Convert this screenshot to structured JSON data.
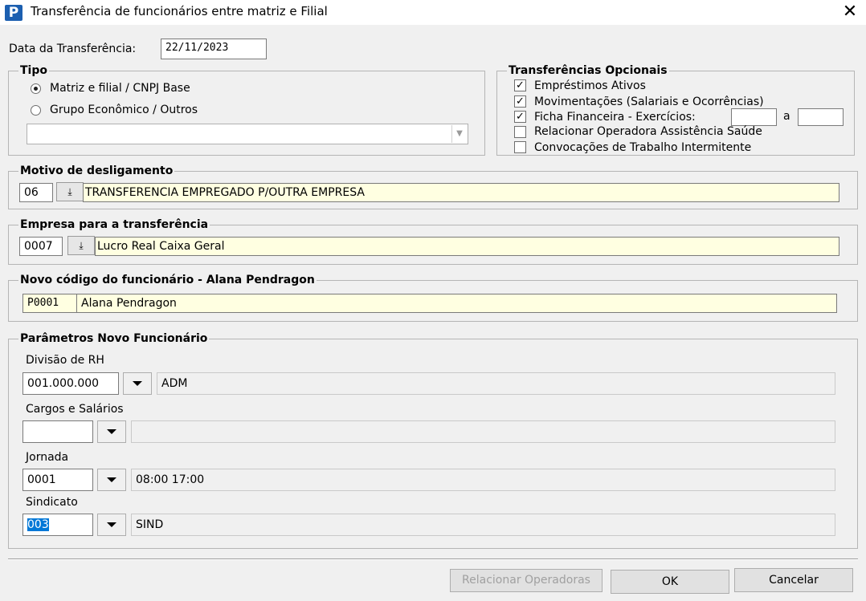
{
  "window": {
    "title": "Transferência de funcionários entre matriz e Filial",
    "icon_letter": "P",
    "close_glyph": "✕"
  },
  "transfer_date": {
    "label": "Data da Transferência:",
    "value": "22/11/2023"
  },
  "tipo": {
    "legend": "Tipo",
    "options": [
      {
        "label": "Matriz e filial / CNPJ Base",
        "selected": true
      },
      {
        "label": "Grupo Econômico / Outros",
        "selected": false
      }
    ],
    "combo_value": ""
  },
  "opcionais": {
    "legend": "Transferências Opcionais",
    "items": [
      {
        "label": "Empréstimos Ativos",
        "checked": true
      },
      {
        "label": "Movimentações (Salariais e Ocorrências)",
        "checked": true
      },
      {
        "label": "Ficha Financeira - Exercícios:",
        "checked": true
      },
      {
        "label": "Relacionar Operadora Assistência Saúde",
        "checked": false
      },
      {
        "label": "Convocações de Trabalho Intermitente",
        "checked": false
      }
    ],
    "range_sep": "a",
    "exercise_from": "",
    "exercise_to": ""
  },
  "motivo": {
    "legend": "Motivo de desligamento",
    "code": "06",
    "description": "TRANSFERENCIA EMPREGADO P/OUTRA EMPRESA",
    "lookup_glyph": "⤓"
  },
  "empresa": {
    "legend": "Empresa para a transferência",
    "code": "0007",
    "description": "Lucro Real Caixa Geral",
    "lookup_glyph": "⤓"
  },
  "novo_codigo": {
    "legend": "Novo código do funcionário - Alana Pendragon",
    "code": "P0001",
    "name": "Alana Pendragon"
  },
  "parametros": {
    "legend": "Parâmetros Novo Funcionário",
    "divisao": {
      "label": "Divisão de RH",
      "code": "001.000.000",
      "description": "ADM"
    },
    "cargos": {
      "label": "Cargos e Salários",
      "code": "",
      "description": ""
    },
    "jornada": {
      "label": "Jornada",
      "code": "0001",
      "description": "08:00 17:00"
    },
    "sindicato": {
      "label": "Sindicato",
      "code": "003",
      "description": "SIND"
    }
  },
  "buttons": {
    "relacionar": "Relacionar Operadoras",
    "ok": "OK",
    "cancel": "Cancelar"
  }
}
